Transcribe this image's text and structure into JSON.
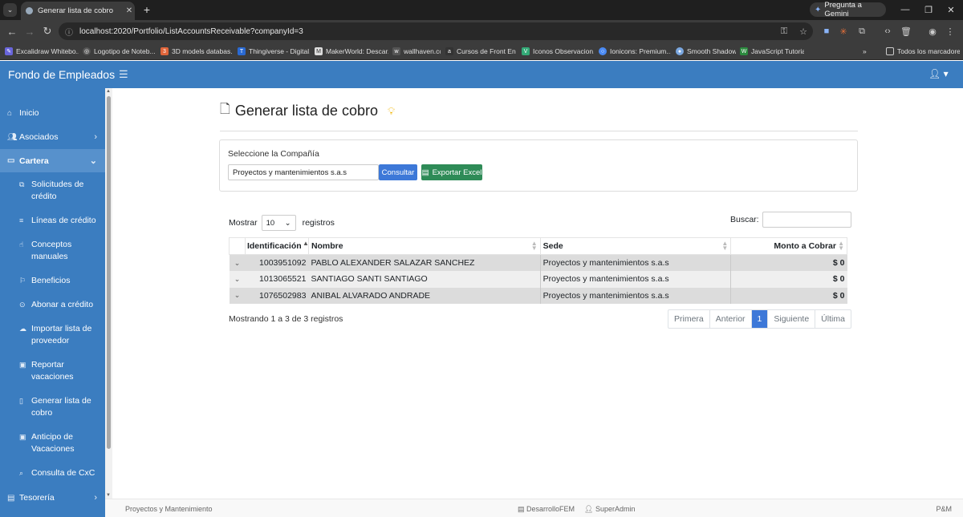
{
  "browser": {
    "tab_title": "Generar lista de cobro",
    "gemini_label": "Pregunta a Gemini",
    "url": "localhost:2020/Portfolio/ListAccountsReceivable?companyId=3",
    "bookmarks": [
      "Excalidraw Whitebo...",
      "Logotipo de Noteb...",
      "3D models databas...",
      "Thingiverse - Digital...",
      "MakerWorld: Descar...",
      "wallhaven.cc",
      "Cursos de Front End...",
      "Iconos Observacion...",
      "Ionicons: Premium...",
      "Smooth Shadow",
      "JavaScript Tutorial"
    ],
    "bookmarks_all": "Todos los marcadores"
  },
  "app": {
    "brand": "Fondo de Empleados"
  },
  "sidebar": {
    "items": [
      {
        "label": "Inicio"
      },
      {
        "label": "Asociados"
      },
      {
        "label": "Cartera"
      },
      {
        "label": "Tesorería"
      }
    ],
    "sub": [
      {
        "label": "Solicitudes de crédito"
      },
      {
        "label": "Líneas de crédito"
      },
      {
        "label": "Conceptos manuales"
      },
      {
        "label": "Beneficios"
      },
      {
        "label": "Abonar a crédito"
      },
      {
        "label": "Importar lista de proveedor"
      },
      {
        "label": "Reportar vacaciones"
      },
      {
        "label": "Generar lista de cobro"
      },
      {
        "label": "Anticipo de Vacaciones"
      },
      {
        "label": "Consulta de CxC"
      }
    ]
  },
  "main": {
    "title": "Generar lista de cobro",
    "company_label": "Seleccione la Compañía",
    "company_value": "Proyectos y mantenimientos s.a.s",
    "consult_button": "Consultar",
    "export_button": "Exportar Excel",
    "show_label": "Mostrar",
    "show_value": "10",
    "records_label": "registros",
    "search_label": "Buscar:",
    "search_value": "",
    "columns": [
      "Identificación",
      "Nombre",
      "Sede",
      "Monto a Cobrar"
    ],
    "rows": [
      {
        "id": "1003951092",
        "name": "PABLO ALEXANDER SALAZAR SANCHEZ",
        "sede": "Proyectos y mantenimientos s.a.s",
        "amount": "$ 0"
      },
      {
        "id": "1013065521",
        "name": "SANTIAGO SANTI SANTIAGO",
        "sede": "Proyectos y mantenimientos s.a.s",
        "amount": "$ 0"
      },
      {
        "id": "1076502983",
        "name": "ANIBAL ALVARADO ANDRADE",
        "sede": "Proyectos y mantenimientos s.a.s",
        "amount": "$ 0"
      }
    ],
    "info": "Mostrando 1 a 3 de 3 registros",
    "pager": {
      "first": "Primera",
      "prev": "Anterior",
      "current": "1",
      "next": "Siguiente",
      "last": "Última"
    }
  },
  "footer": {
    "company": "Proyectos y Mantenimiento",
    "db": "DesarrolloFEM",
    "user": "SuperAdmin",
    "right": "P&M"
  }
}
